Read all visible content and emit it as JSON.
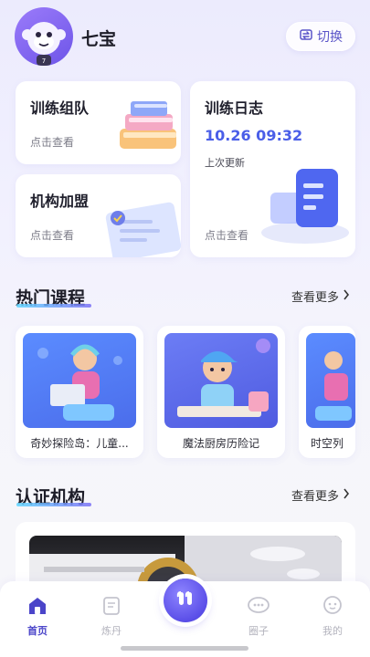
{
  "user": {
    "name": "七宝"
  },
  "header": {
    "switch_label": "切换"
  },
  "cards": {
    "team": {
      "title": "训练组队",
      "sub": "点击查看"
    },
    "log": {
      "title": "训练日志",
      "time": "10.26 09:32",
      "note": "上次更新",
      "sub": "点击查看"
    },
    "org": {
      "title": "机构加盟",
      "sub": "点击查看"
    }
  },
  "courses": {
    "title": "热门课程",
    "more": "查看更多",
    "items": [
      {
        "label": "奇妙探险岛：儿童..."
      },
      {
        "label": "魔法厨房历险记"
      },
      {
        "label": "时空列"
      }
    ]
  },
  "orgs": {
    "title": "认证机构",
    "more": "查看更多"
  },
  "tabbar": {
    "items": [
      {
        "label": "首页",
        "icon": "home-icon",
        "active": true
      },
      {
        "label": "炼丹",
        "icon": "scroll-icon",
        "active": false
      },
      {
        "label": "圈子",
        "icon": "chat-bubble-icon",
        "active": false
      },
      {
        "label": "我的",
        "icon": "profile-icon",
        "active": false
      }
    ]
  },
  "colors": {
    "accent": "#4B45C9",
    "time": "#4A5EE8",
    "background": "#ECEBFD"
  }
}
